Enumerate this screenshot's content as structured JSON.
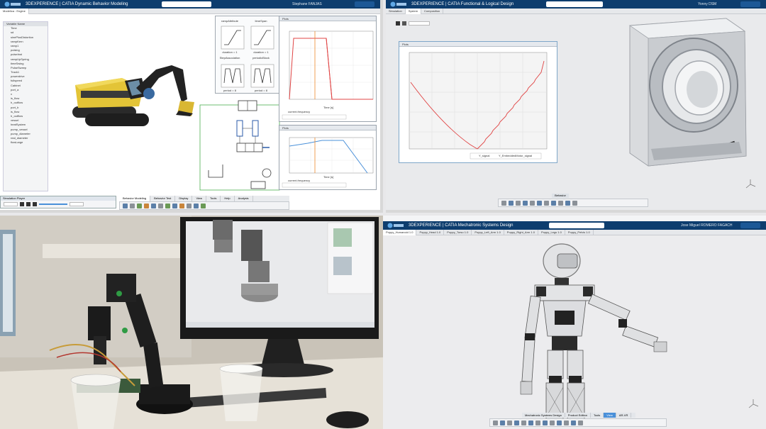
{
  "colors": {
    "title_bar": "#0d3d6e",
    "excavator_yellow": "#e3c437",
    "plot_red": "#e04444",
    "plot_orange": "#ee8a2a",
    "plot_blue": "#4a90d9"
  },
  "q1": {
    "app_title": "3DEXPERIENCE | CATIA Dynamic Behavior Modeling",
    "tab": "Modelica : Engine",
    "user": "Stephane FANJAS",
    "tree_header": "Variable Name",
    "tree_items": [
      "Time",
      "sd",
      "sinePlusDistortion",
      "rampKern",
      "ramp1",
      "pulsing",
      "pulseInst",
      "rampUpSpring",
      "timeSwing",
      "PulseSweep",
      "Track1",
      "powerdrive",
      "fullspeed",
      "Cabinet",
      "port_a",
      "x",
      "is_flow",
      "h_outflow",
      "port_b",
      "is_flow",
      "h_outflow",
      "vessel",
      "heatSystem",
      "pump_vessel",
      "pump_diameter",
      "real_diameter",
      "flowLarge"
    ],
    "block_labels": [
      "rampAttribute",
      "timeSpan",
      "duration = 1",
      "duration = 1",
      "StepAssociation",
      "periodicBlock",
      "period = 8",
      "period = 8"
    ],
    "plot1": {
      "title": "Plots",
      "xlabel": "Time [s]",
      "legend": "current.frequency"
    },
    "plot2": {
      "title": "Plots",
      "xlabel": "Time [s]",
      "legend": "current.frequency"
    },
    "sim_player": "Simulation Player",
    "bottom_tabs": [
      "Behavior Modeling",
      "Behavior Test",
      "Display",
      "View",
      "Tools",
      "Help",
      "Analysis"
    ]
  },
  "q2": {
    "app_title": "3DEXPERIENCE | CATIA Functional & Logical Design",
    "user": "Yonny DSM",
    "tabs": [
      "Simulation",
      "System",
      "Composition"
    ],
    "plot_title": "Plots",
    "legend_items": [
      "Y_signal",
      "Y_EmbeddedMotor_signal"
    ],
    "bottom_tab": "Behavior"
  },
  "q4": {
    "app_title": "3DEXPERIENCE | CATIA Mechatronic Systems Design",
    "user": "Jose Miguel ROMERO FAGACH",
    "tabs": [
      "Poppy_Humanoid 1.0",
      "Poppy_Head 1.0",
      "Poppy_Torso 1.0",
      "Poppy_Left_Arm 1.0",
      "Poppy_Right_Arm 1.0",
      "Poppy_Legs 1.0",
      "Poppy_Pelvis 1.0"
    ],
    "bottom_tabs": [
      "Mechatronic Systems Design",
      "Product Edition",
      "Tools",
      "View",
      "AR-VR"
    ]
  }
}
